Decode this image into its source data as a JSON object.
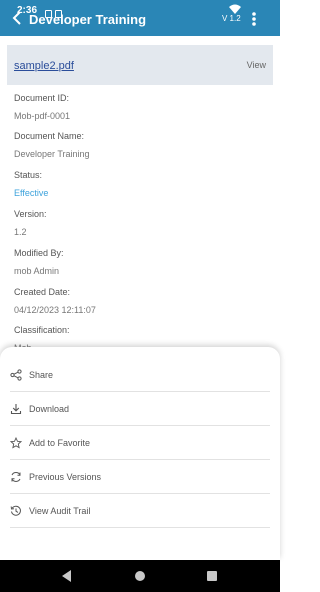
{
  "status_bar": {
    "time": "2:36"
  },
  "header": {
    "title": "Developer Training",
    "version": "V 1.2"
  },
  "file": {
    "name": "sample2.pdf",
    "action": "View"
  },
  "fields": [
    {
      "label": "Document ID:",
      "value": "Mob-pdf-0001"
    },
    {
      "label": "Document Name:",
      "value": "Developer Training"
    },
    {
      "label": "Status:",
      "value": "Effective"
    },
    {
      "label": "Version:",
      "value": "1.2"
    },
    {
      "label": "Modified By:",
      "value": "mob Admin"
    },
    {
      "label": "Created Date:",
      "value": "04/12/2023 12:11:07"
    },
    {
      "label": "Classification:",
      "value": "Mob"
    }
  ],
  "colors": {
    "appbar": "#2a86b6",
    "accent": "#3ea3dc",
    "file_card": "#e3e8ee"
  },
  "sheet": {
    "items": [
      {
        "label": "Share",
        "icon": "share-icon"
      },
      {
        "label": "Download",
        "icon": "download-icon"
      },
      {
        "label": "Add to Favorite",
        "icon": "star-icon"
      },
      {
        "label": "Previous Versions",
        "icon": "versions-icon"
      },
      {
        "label": "View Audit Trail",
        "icon": "history-icon"
      }
    ]
  }
}
